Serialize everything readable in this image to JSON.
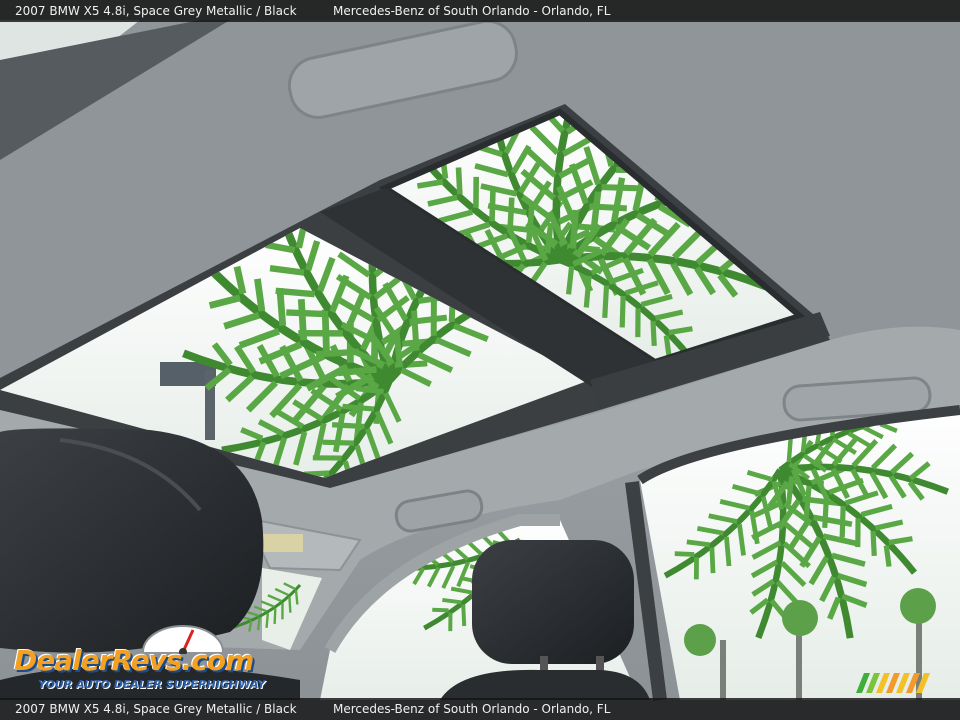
{
  "caption": {
    "vehicle": "2007 BMW X5 4.8i,  Space Grey Metallic / Black",
    "dealer": "Mercedes-Benz of South Orlando - Orlando, FL"
  },
  "watermark": {
    "brand": "DealerRevs.com",
    "tagline": "YOUR AUTO DEALER SUPERHIGHWAY"
  },
  "colors": {
    "headliner": "#8e9498",
    "sky": "#f2f5f3",
    "palm": "#4f9a3a",
    "seat": "#2b2e31",
    "caption_bg": "#141414"
  }
}
